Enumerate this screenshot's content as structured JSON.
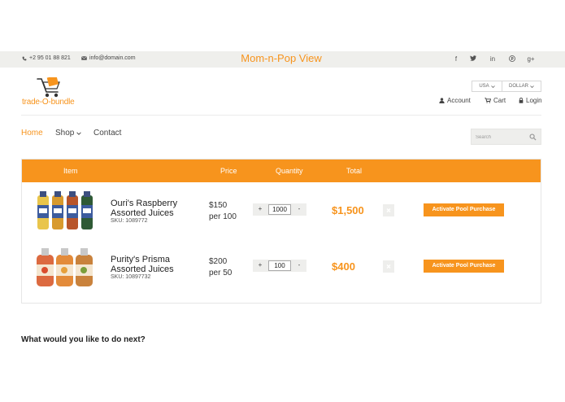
{
  "topbar": {
    "phone": "+2 95 01 88 821",
    "email": "info@domain.com",
    "title": "Mom-n-Pop View",
    "social": [
      {
        "icon": "facebook-icon",
        "glyph": "f"
      },
      {
        "icon": "twitter-icon",
        "glyph": "→"
      },
      {
        "icon": "linkedin-icon",
        "glyph": "in"
      },
      {
        "icon": "pinterest-icon",
        "glyph": "℗"
      },
      {
        "icon": "google-plus-icon",
        "glyph": "g+"
      }
    ]
  },
  "logo": {
    "text": "trade-O-bundle"
  },
  "selectors": {
    "country": "USA",
    "currency": "DOLLAR"
  },
  "account_links": {
    "account": "Account",
    "cart": "Cart",
    "login": "Login"
  },
  "nav": {
    "home": "Home",
    "shop": "Shop",
    "contact": "Contact"
  },
  "search": {
    "placeholder": "Search"
  },
  "cart": {
    "headers": {
      "item": "Item",
      "price": "Price",
      "quantity": "Quantity",
      "total": "Total"
    },
    "rows": [
      {
        "name_line1": "Ouri's Raspberry",
        "name_line2": "Assorted Juices",
        "sku": "SKU: 1089772",
        "price_line1": "$150",
        "price_line2": "per 100",
        "qty": "1000",
        "total": "$1,500",
        "button": "Activate Pool Purchase"
      },
      {
        "name_line1": "Purity's Prisma",
        "name_line2": "Assorted Juices",
        "sku": "SKU: 10897732",
        "price_line1": "$200",
        "price_line2": "per 50",
        "qty": "100",
        "total": "$400",
        "button": "Activate Pool Purchase"
      }
    ],
    "qty_plus": "+",
    "qty_minus": "-"
  },
  "next_heading": "What would you like to do next?",
  "colors": {
    "accent": "#f7941d",
    "topbar_bg": "#efefec"
  }
}
